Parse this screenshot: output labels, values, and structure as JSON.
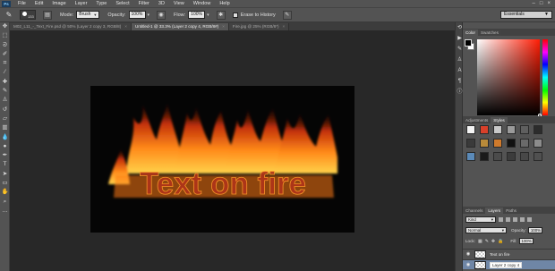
{
  "app": {
    "logo": "Ps"
  },
  "menu": {
    "items": [
      "File",
      "Edit",
      "Image",
      "Layer",
      "Type",
      "Select",
      "Filter",
      "3D",
      "View",
      "Window",
      "Help"
    ],
    "window_controls": [
      "–",
      "□",
      "×"
    ]
  },
  "options_bar": {
    "tool_icon": "brush-icon",
    "brush_size": "133",
    "mode_label": "Mode:",
    "mode_value": "Brush",
    "opacity_label": "Opacity:",
    "opacity_value": "100%",
    "flow_label": "Flow:",
    "flow_value": "100%",
    "erase_to_history_label": "Erase to History",
    "workspace": "Essentials"
  },
  "tabs": [
    {
      "title": "M02_L11_-_Text_Fire.psd @ 50% (Layer 2 copy 3, RGB/8)",
      "active": false
    },
    {
      "title": "Untitled-1 @ 33.3% (Layer 2 copy 4, RGB/8#)",
      "active": true
    },
    {
      "title": "Fire.jpg @ 25% (RGB/8*)",
      "active": false
    }
  ],
  "document": {
    "text": "Text on fire",
    "text_color": "#c0392b",
    "fire_colors": [
      "#ffd24a",
      "#ff8a1a",
      "#c2300a",
      "#5a1004"
    ]
  },
  "tools": [
    "move-icon",
    "marquee-icon",
    "lasso-icon",
    "quick-select-icon",
    "crop-icon",
    "eyedropper-icon",
    "healing-icon",
    "brush-icon",
    "clone-stamp-icon",
    "history-brush-icon",
    "eraser-icon",
    "gradient-icon",
    "blur-icon",
    "dodge-icon",
    "pen-icon",
    "type-icon",
    "path-select-icon",
    "rectangle-icon",
    "hand-icon",
    "zoom-icon"
  ],
  "color_panel": {
    "tabs": [
      "Color",
      "Swatches"
    ],
    "foreground": "#000000",
    "background": "#ffffff",
    "hue_color": "#ff1d05"
  },
  "styles_panel": {
    "tabs": [
      "Adjustments",
      "Styles"
    ],
    "swatches": [
      "#f4f4f4",
      "#d9402a",
      "#c8c8c8",
      "#9a9a9a",
      "#5f5f5f",
      "#2c2c2c",
      "#3a3a3a",
      "#b88a3a",
      "#cf7a2c",
      "#111111",
      "#6a6a6a",
      "#8c8c8c",
      "#5b8ab8",
      "#1a1a1a",
      "#4b4b4b",
      "#3c3c3c",
      "#484848",
      "#505050"
    ]
  },
  "layers_panel": {
    "tabs": [
      "Channels",
      "Layers",
      "Paths"
    ],
    "filter_kind": "Kind",
    "blend_mode": "Normal",
    "opacity_label": "Opacity:",
    "opacity_value": "100%",
    "lock_label": "Lock:",
    "fill_label": "Fill:",
    "fill_value": "100%",
    "layers": [
      {
        "name": "Text on fire",
        "selected": false
      },
      {
        "name": "Layer 2 copy 4",
        "selected": true
      }
    ]
  }
}
